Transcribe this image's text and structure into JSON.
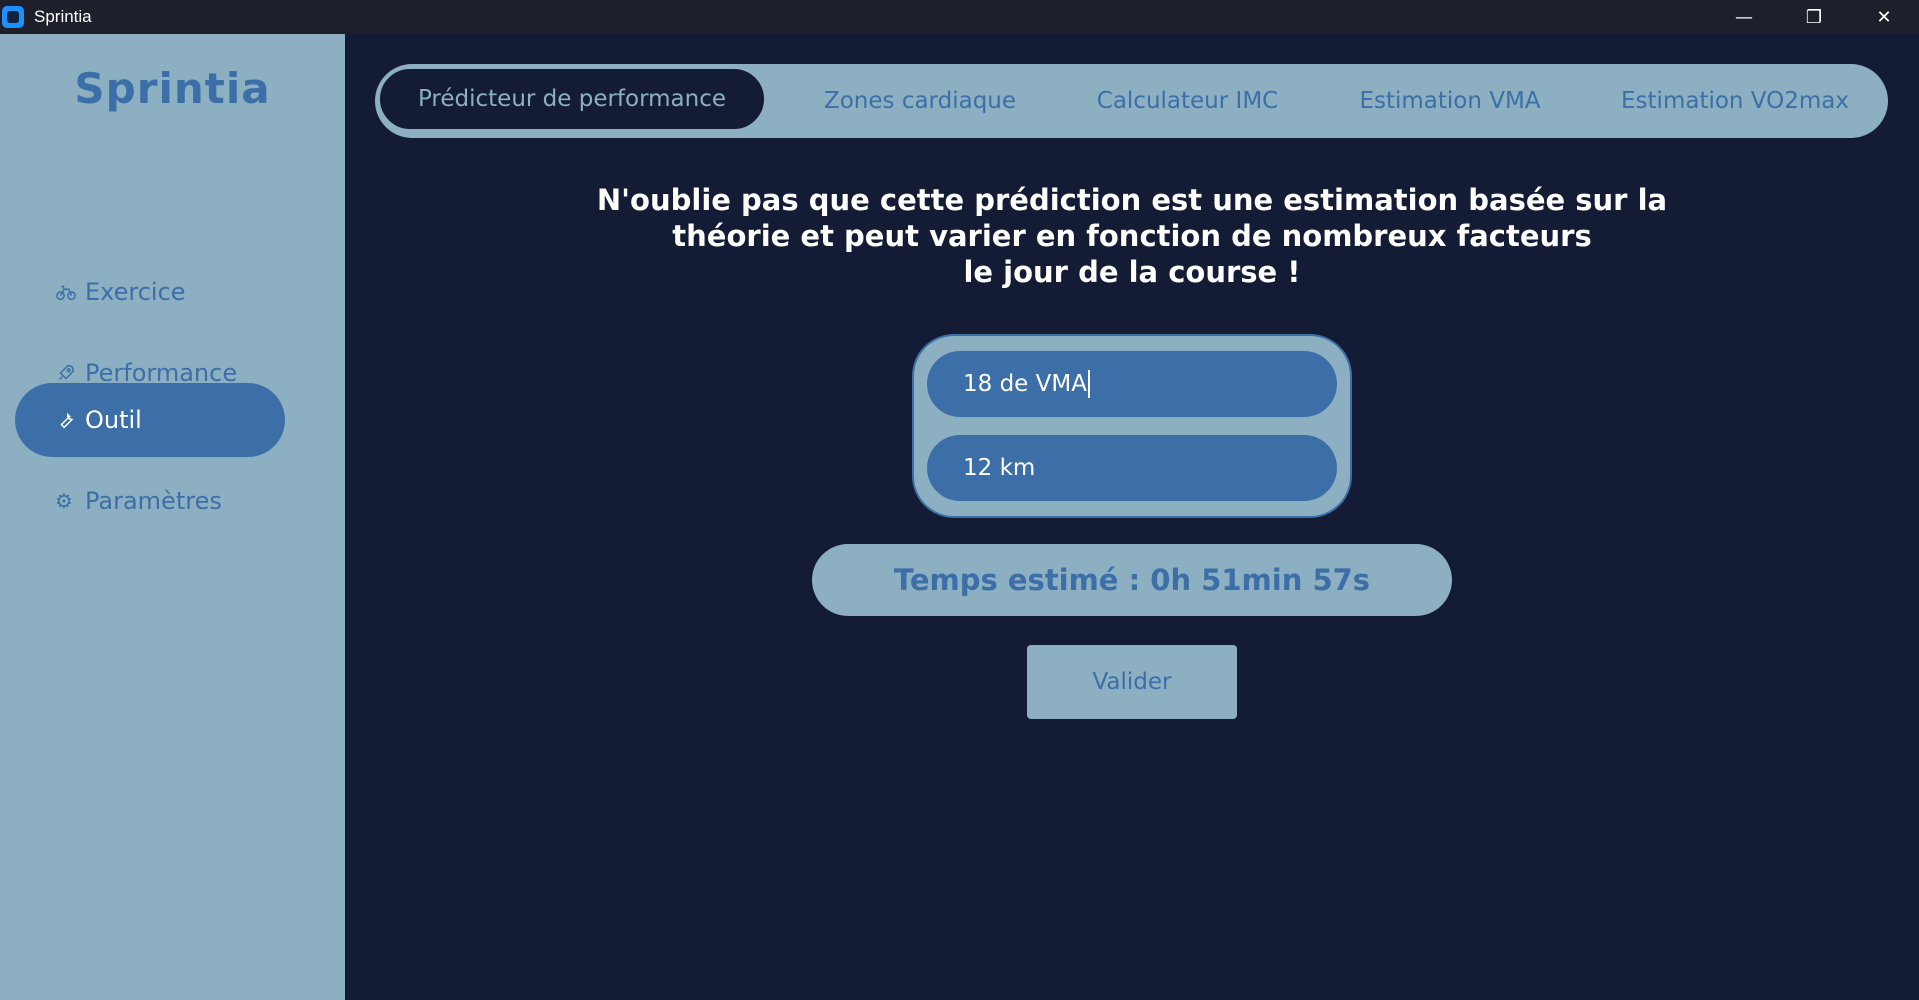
{
  "window": {
    "title": "Sprintia",
    "controls": {
      "minimize": "—",
      "restore": "❐",
      "close": "✕"
    }
  },
  "sidebar": {
    "brand": "Sprintia",
    "items": [
      {
        "label": "Exercice",
        "icon": "bike-icon",
        "active": false
      },
      {
        "label": "Performance",
        "icon": "rocket-icon",
        "active": false
      },
      {
        "label": "Outil",
        "icon": "wrench-icon",
        "active": true
      },
      {
        "label": "Paramètres",
        "icon": "gear-icon",
        "active": false
      }
    ]
  },
  "tabs": [
    {
      "label": "Prédicteur de performance",
      "active": true
    },
    {
      "label": "Zones cardiaque",
      "active": false
    },
    {
      "label": "Calculateur IMC",
      "active": false
    },
    {
      "label": "Estimation VMA",
      "active": false
    },
    {
      "label": "Estimation VO2max",
      "active": false
    }
  ],
  "notice": {
    "line1": "N'oublie pas que cette prédiction est une estimation basée sur la",
    "line2": "théorie et peut varier en fonction de nombreux facteurs",
    "line3": "le jour de la course !"
  },
  "inputs": {
    "vma_value": "18 de VMA",
    "distance_value": "12 km"
  },
  "result": "Temps estimé : 0h 51min 57s",
  "buttons": {
    "validate": "Valider"
  },
  "colors": {
    "background": "#141c35",
    "sidebar": "#8cb0c1",
    "accent": "#3c6fa8",
    "text": "#ffffff"
  }
}
